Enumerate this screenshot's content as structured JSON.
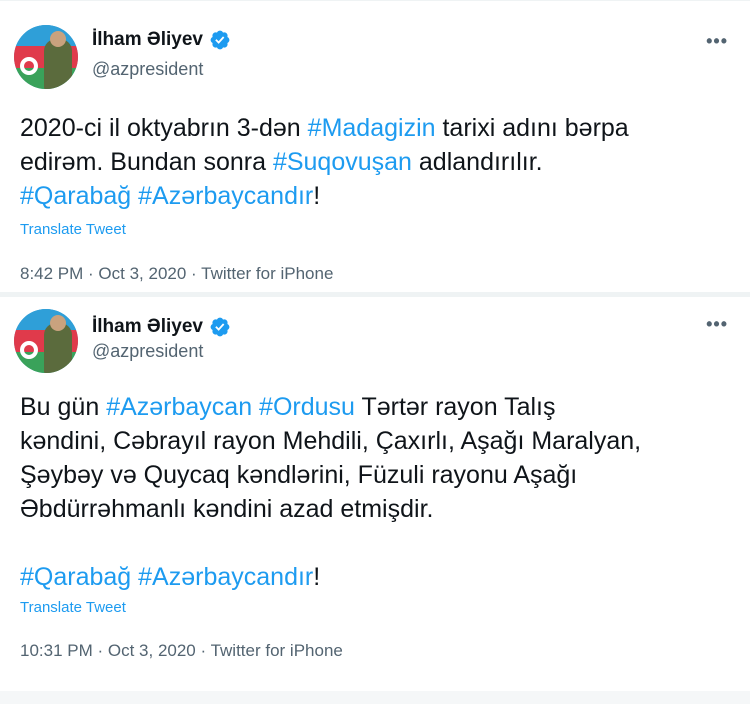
{
  "tweets": [
    {
      "author_name": "İlham Əliyev",
      "handle": "@azpresident",
      "text_lines": [
        [
          {
            "t": "2020-ci il oktyabrın 3-dən "
          },
          {
            "t": "#Madagizin",
            "tag": true
          },
          {
            "t": " tarixi adını bərpa"
          }
        ],
        [
          {
            "t": "edirəm. Bundan sonra "
          },
          {
            "t": "#Suqovuşan",
            "tag": true
          },
          {
            "t": " adlandırılır."
          }
        ],
        [
          {
            "t": "#Qarabağ #Azərbaycandır",
            "tag": true
          },
          {
            "t": "!"
          }
        ]
      ],
      "translate_label": "Translate Tweet",
      "time": "8:42 PM",
      "date": "Oct 3, 2020",
      "source": "Twitter for iPhone"
    },
    {
      "author_name": "İlham Əliyev",
      "handle": "@azpresident",
      "text_lines": [
        [
          {
            "t": "Bu gün "
          },
          {
            "t": "#Azərbaycan #Ordusu",
            "tag": true
          },
          {
            "t": " Tərtər rayon Talış"
          }
        ],
        [
          {
            "t": "kəndini, Cəbrayıl rayon Mehdili, Çaxırlı, Aşağı Maralyan,"
          }
        ],
        [
          {
            "t": "Şəybəy və Quycaq kəndlərini, Füzuli rayonu Aşağı"
          }
        ],
        [
          {
            "t": "Əbdürrəhmanlı kəndini azad etmişdir."
          }
        ],
        [
          {
            "t": ""
          }
        ],
        [
          {
            "t": "#Qarabağ #Azərbaycandır",
            "tag": true
          },
          {
            "t": "!"
          }
        ]
      ],
      "translate_label": "Translate Tweet",
      "time": "10:31 PM",
      "date": "Oct 3, 2020",
      "source": "Twitter for iPhone"
    }
  ],
  "icons": {
    "more": "more-horizontal-icon",
    "verified": "verified-badge-icon"
  },
  "colors": {
    "link": "#1d9bf0",
    "text": "#0f1419",
    "muted": "#536471"
  },
  "more_glyph": "•••",
  "meta_separator": " · "
}
